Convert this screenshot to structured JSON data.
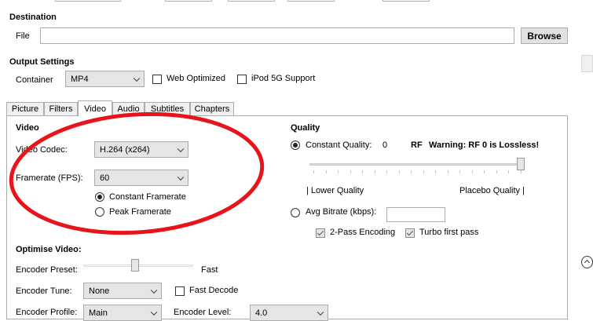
{
  "destination": {
    "title": "Destination",
    "file_label": "File",
    "file_value": "",
    "browse_label": "Browse"
  },
  "output_settings": {
    "title": "Output Settings",
    "container_label": "Container",
    "container_value": "MP4",
    "web_optimized_label": "Web Optimized",
    "web_optimized_checked": false,
    "ipod_label": "iPod 5G Support",
    "ipod_checked": false
  },
  "tabs": [
    {
      "label": "Picture"
    },
    {
      "label": "Filters"
    },
    {
      "label": "Video",
      "active": true
    },
    {
      "label": "Audio"
    },
    {
      "label": "Subtitles"
    },
    {
      "label": "Chapters"
    }
  ],
  "video": {
    "title": "Video",
    "codec_label": "Video Codec:",
    "codec_value": "H.264 (x264)",
    "framerate_label": "Framerate (FPS):",
    "framerate_value": "60",
    "constant_framerate_label": "Constant Framerate",
    "peak_framerate_label": "Peak Framerate",
    "selected_mode": "constant"
  },
  "quality": {
    "title": "Quality",
    "constant_quality_label": "Constant Quality:",
    "constant_quality_value": "0",
    "rf_label": "RF",
    "warning_text": "Warning: RF 0 is Lossless!",
    "lower_quality_label": "| Lower Quality",
    "placebo_quality_label": "Placebo Quality |",
    "avg_bitrate_label": "Avg Bitrate (kbps):",
    "avg_bitrate_value": "",
    "two_pass_label": "2-Pass Encoding",
    "two_pass_checked": true,
    "turbo_label": "Turbo first pass",
    "turbo_checked": true,
    "slider_level_fraction": 1.0
  },
  "optimise": {
    "title": "Optimise Video:",
    "preset_label": "Encoder Preset:",
    "preset_value_label": "Fast",
    "preset_slider_fraction": 0.47,
    "tune_label": "Encoder Tune:",
    "tune_value": "None",
    "fast_decode_label": "Fast Decode",
    "fast_decode_checked": false,
    "profile_label": "Encoder Profile:",
    "profile_value": "Main",
    "level_label": "Encoder Level:",
    "level_value": "4.0"
  },
  "annotation": {
    "color": "#e8141c"
  }
}
